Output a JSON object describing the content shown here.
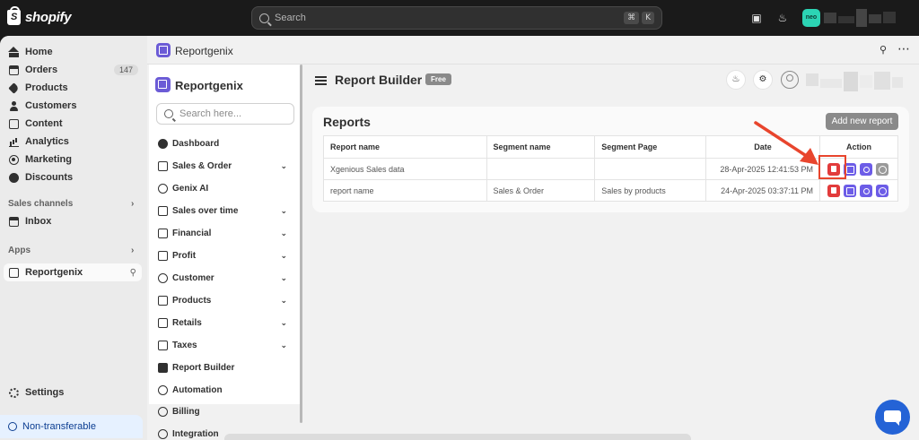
{
  "topbar": {
    "brand": "shopify",
    "search_placeholder": "Search",
    "shortcut_keys": [
      "⌘",
      "K"
    ],
    "store_initials": "neo"
  },
  "nav": {
    "items": [
      {
        "label": "Home",
        "icon": "home-icon"
      },
      {
        "label": "Orders",
        "icon": "orders-icon",
        "badge": "147"
      },
      {
        "label": "Products",
        "icon": "tag-icon"
      },
      {
        "label": "Customers",
        "icon": "person-icon"
      },
      {
        "label": "Content",
        "icon": "content-icon"
      },
      {
        "label": "Analytics",
        "icon": "bar-chart-icon"
      },
      {
        "label": "Marketing",
        "icon": "target-icon"
      },
      {
        "label": "Discounts",
        "icon": "discount-icon"
      }
    ],
    "sales_channels_label": "Sales channels",
    "inbox_label": "Inbox",
    "apps_label": "Apps",
    "active_app_label": "Reportgenix",
    "settings_label": "Settings",
    "non_transferable_label": "Non-transferable"
  },
  "app": {
    "header_title": "Reportgenix",
    "brand": "Reportgenix",
    "search_placeholder": "Search here...",
    "menu": [
      {
        "label": "Dashboard",
        "expandable": false
      },
      {
        "label": "Sales & Order",
        "expandable": true
      },
      {
        "label": "Genix AI",
        "expandable": false
      },
      {
        "label": "Sales over time",
        "expandable": true
      },
      {
        "label": "Financial",
        "expandable": true
      },
      {
        "label": "Profit",
        "expandable": true
      },
      {
        "label": "Customer",
        "expandable": true
      },
      {
        "label": "Products",
        "expandable": true
      },
      {
        "label": "Retails",
        "expandable": true
      },
      {
        "label": "Taxes",
        "expandable": true
      },
      {
        "label": "Report Builder",
        "expandable": false
      },
      {
        "label": "Automation",
        "expandable": false
      },
      {
        "label": "Billing",
        "expandable": false
      },
      {
        "label": "Integration",
        "expandable": false
      }
    ]
  },
  "page": {
    "title": "Report Builder",
    "plan_badge": "Free"
  },
  "reports": {
    "title": "Reports",
    "add_button": "Add new report",
    "columns": [
      "Report name",
      "Segment name",
      "Segment Page",
      "Date",
      "Action"
    ],
    "rows": [
      {
        "name": "Xgenious Sales data",
        "segment": "",
        "segment_page": "",
        "date": "28-Apr-2025 12:41:53 PM"
      },
      {
        "name": "report name",
        "segment": "Sales & Order",
        "segment_page": "Sales by products",
        "date": "24-Apr-2025 03:37:11 PM"
      }
    ]
  },
  "colors": {
    "accent": "#6c5ce7",
    "delete": "#e23b3b",
    "annotation": "#e8452d",
    "chat": "#2463d6"
  }
}
